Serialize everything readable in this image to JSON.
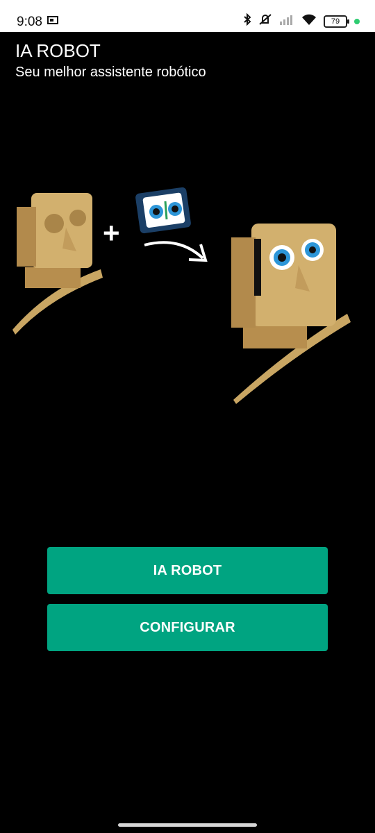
{
  "status_bar": {
    "time": "9:08",
    "battery_level": "79",
    "icons": [
      "screen-mirror-icon",
      "bluetooth-icon",
      "do-not-disturb-icon",
      "cellular-signal-icon",
      "wifi-icon",
      "battery-icon"
    ]
  },
  "header": {
    "title": "IA ROBOT",
    "subtitle": "Seu melhor assistente robótico"
  },
  "illustration": {
    "operator": "+"
  },
  "buttons": {
    "ia_robot_label": "IA ROBOT",
    "configure_label": "CONFIGURAR"
  },
  "colors": {
    "background": "#000000",
    "button": "#00A481",
    "wood": "#D2B06E"
  }
}
